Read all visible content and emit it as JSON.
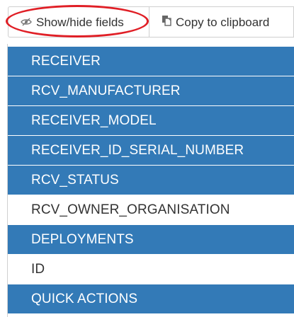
{
  "toolbar": {
    "show_hide_label": "Show/hide fields",
    "copy_label": "Copy to clipboard",
    "show_hide_icon": "eye-slash-icon",
    "copy_icon": "clipboard-icon",
    "highlight_color": "#e01f26"
  },
  "columns_menu": {
    "selected_color": "#337ab7",
    "items": [
      {
        "label": "RECEIVER",
        "visible": true
      },
      {
        "label": "RCV_MANUFACTURER",
        "visible": true
      },
      {
        "label": "RECEIVER_MODEL",
        "visible": true
      },
      {
        "label": "RECEIVER_ID_SERIAL_NUMBER",
        "visible": true
      },
      {
        "label": "RCV_STATUS",
        "visible": true
      },
      {
        "label": "RCV_OWNER_ORGANISATION",
        "visible": false
      },
      {
        "label": "DEPLOYMENTS",
        "visible": true
      },
      {
        "label": "ID",
        "visible": false
      },
      {
        "label": "QUICK ACTIONS",
        "visible": true
      }
    ]
  }
}
